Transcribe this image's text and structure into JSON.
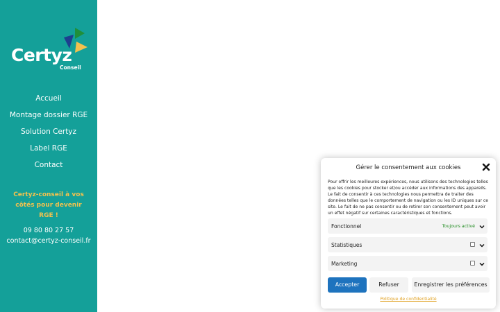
{
  "brand": {
    "name": "Certyz",
    "sub": "Conseil",
    "colors": {
      "teal": "#14a099",
      "green": "#1f8f3a",
      "navy": "#1d3f8f",
      "yellow": "#f2c14e"
    }
  },
  "nav": {
    "items": [
      {
        "label": "Accueil"
      },
      {
        "label": "Montage dossier RGE"
      },
      {
        "label": "Solution Certyz"
      },
      {
        "label": "Label RGE"
      },
      {
        "label": "Contact"
      }
    ]
  },
  "sidebar": {
    "tagline": "Certyz-conseil à vos côtés pour devenir RGE !",
    "phone": "09 80 80 27 57",
    "email": "contact@certyz-conseil.fr"
  },
  "cookie": {
    "title": "Gérer le consentement aux cookies",
    "close_icon": "close-icon",
    "text": "Pour offrir les meilleures expériences, nous utilisons des technologies telles que les cookies pour stocker et/ou accéder aux informations des appareils. Le fait de consentir à ces technologies nous permettra de traiter des données telles que le comportement de navigation ou les ID uniques sur ce site. Le fait de ne pas consentir ou de retirer son consentement peut avoir un effet négatif sur certaines caractéristiques et fonctions.",
    "categories": [
      {
        "label": "Fonctionnel",
        "status": "Toujours activé"
      },
      {
        "label": "Statistiques",
        "checked": false
      },
      {
        "label": "Marketing",
        "checked": false
      }
    ],
    "buttons": {
      "accept": "Accepter",
      "refuse": "Refuser",
      "prefs": "Enregistrer les préférences"
    },
    "policy_link": "Politique de confidentialité"
  }
}
